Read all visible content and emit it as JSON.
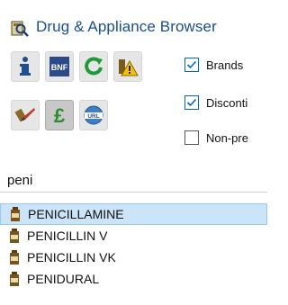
{
  "window": {
    "title": "Drug & Appliance Browser"
  },
  "toolbar": {
    "buttons": [
      {
        "name": "info",
        "label": "i"
      },
      {
        "name": "bnf",
        "label": "BNF"
      },
      {
        "name": "refresh",
        "label": ""
      },
      {
        "name": "warning",
        "label": ""
      },
      {
        "name": "pen",
        "label": ""
      },
      {
        "name": "pound",
        "label": "£"
      },
      {
        "name": "url",
        "label": "URL"
      }
    ],
    "checkboxes": [
      {
        "label": "Brands",
        "checked": true
      },
      {
        "label": "Disconti",
        "checked": true
      },
      {
        "label": "Non-pre",
        "checked": false
      }
    ]
  },
  "search": {
    "value": "peni"
  },
  "results": [
    {
      "label": "PENICILLAMINE",
      "selected": true
    },
    {
      "label": "PENICILLIN V",
      "selected": false
    },
    {
      "label": "PENICILLIN VK",
      "selected": false
    },
    {
      "label": "PENIDURAL",
      "selected": false
    }
  ],
  "colors": {
    "title": "#1a4f8e",
    "selection": "#cce4f7",
    "checkAccent": "#0067c0",
    "pound": "#2e8b2e"
  }
}
